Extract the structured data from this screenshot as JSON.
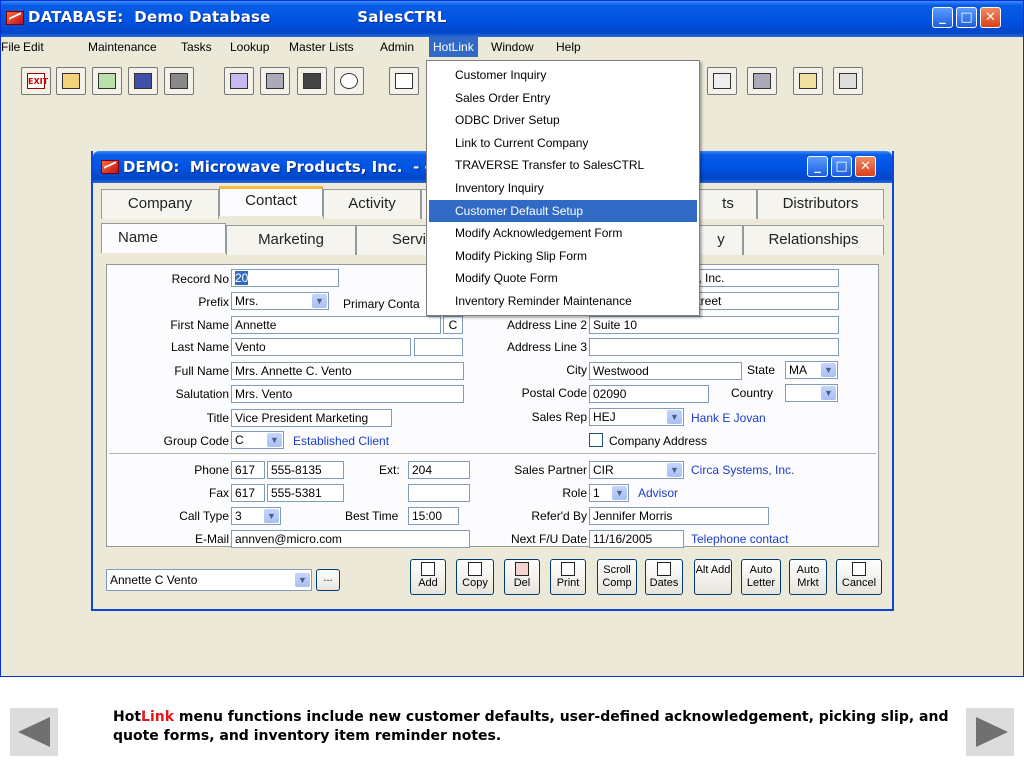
{
  "window": {
    "title": "DATABASE:  Demo Database                SalesCTRL"
  },
  "menubar": [
    "File",
    "Edit",
    "Maintenance",
    "Tasks",
    "Lookup",
    "Master Lists",
    "Admin",
    "HotLink",
    "Window",
    "Help"
  ],
  "toolbar": {
    "exit_label": "EXIT",
    "icons": [
      "exit-icon",
      "folder-icon",
      "chart-icon",
      "word-icon",
      "printer-icon",
      "notepad-icon",
      "calculator-icon",
      "binoculars-icon",
      "clock-icon",
      "calendar-icon",
      "network-icon",
      "dictionary-icon",
      "ledger-icon",
      "document-icon"
    ]
  },
  "hotlink_menu": {
    "items": [
      "Customer Inquiry",
      "Sales Order Entry",
      "ODBC Driver Setup",
      "Link to Current Company",
      "TRAVERSE Transfer to SalesCTRL",
      "Inventory Inquiry",
      "Customer Default Setup",
      "Modify Acknowledgement Form",
      "Modify Picking Slip Form",
      "Modify Quote Form",
      "Inventory Reminder Maintenance"
    ],
    "highlighted": "Customer Default Setup"
  },
  "inner_window": {
    "title": "DEMO:  Microwave Products, Inc.  - - A",
    "tabs_row1": [
      "Company",
      "Contact",
      "Activity",
      "",
      "ts",
      "Distributors"
    ],
    "tabs_row2": [
      "Name",
      "Marketing",
      "Servi",
      "y",
      "Relationships"
    ]
  },
  "form": {
    "record_no_label": "Record No",
    "record_no": "20",
    "prefix_label": "Prefix",
    "prefix": "Mrs.",
    "primary_contact_label": "Primary Conta",
    "first_name_label": "First Name",
    "first_name": "Annette",
    "first_name_flag": "C",
    "last_name_label": "Last Name",
    "last_name": "Vento",
    "full_name_label": "Full Name",
    "full_name": "Mrs. Annette C. Vento",
    "salutation_label": "Salutation",
    "salutation": "Mrs. Vento",
    "title_label": "Title",
    "title": "Vice President Marketing",
    "group_code_label": "Group Code",
    "group_code": "C",
    "group_code_desc": "Established Client",
    "company_name_partial": "cts, Inc.",
    "address1_partial": "r Street",
    "address_line2_label": "Address Line 2",
    "address_line2": "Suite 10",
    "address_line3_label": "Address Line 3",
    "address_line3": "",
    "city_label": "City",
    "city": "Westwood",
    "state_label": "State",
    "state": "MA",
    "postal_code_label": "Postal Code",
    "postal_code": "02090",
    "country_label": "Country",
    "country": "",
    "sales_rep_label": "Sales Rep",
    "sales_rep": "HEJ",
    "sales_rep_name": "Hank E Jovan",
    "company_address_label": "Company Address",
    "phone_label": "Phone",
    "phone_area": "617",
    "phone_num": "555-8135",
    "ext_label": "Ext:",
    "ext": "204",
    "fax_label": "Fax",
    "fax_area": "617",
    "fax_num": "555-5381",
    "call_type_label": "Call Type",
    "call_type": "3",
    "best_time_label": "Best Time",
    "best_time": "15:00",
    "email_label": "E-Mail",
    "email": "annven@micro.com",
    "sales_partner_label": "Sales Partner",
    "sales_partner": "CIR",
    "sales_partner_name": "Circa Systems, Inc.",
    "role_label": "Role",
    "role": "1",
    "role_name": "Advisor",
    "referd_by_label": "Refer'd By",
    "referd_by": "Jennifer Morris",
    "next_fu_label": "Next F/U Date",
    "next_fu": "11/16/2005",
    "next_fu_note": "Telephone contact"
  },
  "bottom_bar": {
    "contact_select": "Annette C Vento",
    "ellipsis": "...",
    "buttons": [
      "Add",
      "Copy",
      "Del",
      "Print",
      "Scroll Comp",
      "Dates",
      "Alt Add",
      "Auto Letter",
      "Auto Mrkt",
      "Cancel"
    ]
  },
  "caption": {
    "hot": "Hot",
    "link": "Link",
    "rest": " menu functions include new customer defaults, user-defined acknowledgement, picking slip, and quote forms, and inventory item reminder notes."
  },
  "colors": {
    "accent": "#316ac5",
    "titlebar": "#0054e3",
    "link_red": "#e8151a",
    "link_blue": "#1c3cc8"
  }
}
